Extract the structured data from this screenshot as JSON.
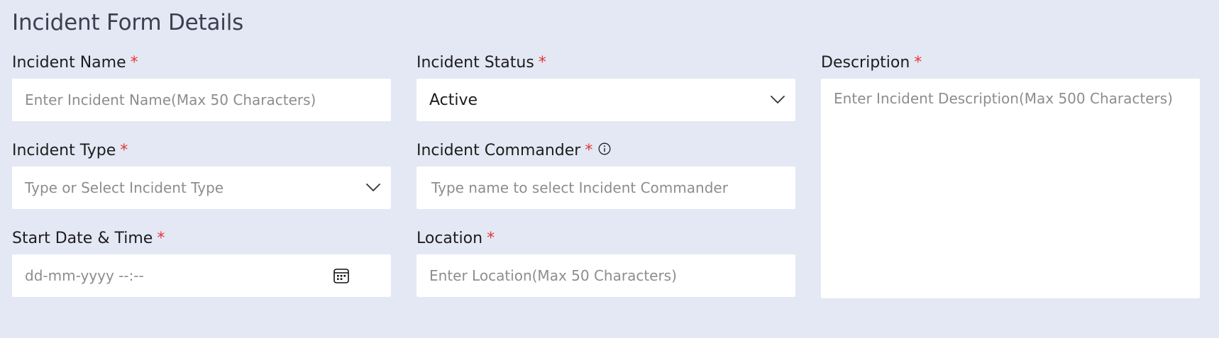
{
  "page": {
    "title": "Incident Form Details",
    "required_marker": "*"
  },
  "fields": {
    "incident_name": {
      "label": "Incident Name",
      "placeholder": "Enter Incident Name(Max 50 Characters)"
    },
    "incident_status": {
      "label": "Incident Status",
      "value": "Active"
    },
    "description": {
      "label": "Description",
      "placeholder": "Enter Incident Description(Max 500 Characters)"
    },
    "incident_type": {
      "label": "Incident Type",
      "placeholder": "Type or Select Incident Type"
    },
    "incident_commander": {
      "label": "Incident Commander",
      "placeholder": "Type name to select Incident Commander"
    },
    "start_datetime": {
      "label": "Start Date & Time",
      "placeholder": "dd-mm-yyyy --:--"
    },
    "location": {
      "label": "Location",
      "placeholder": "Enter Location(Max 50 Characters)"
    }
  },
  "colors": {
    "background": "#e4e8f4",
    "required": "#e5353a",
    "placeholder": "#8d8d8d",
    "field_background": "#ffffff"
  },
  "icons": {
    "dropdown": "chevron-down-icon",
    "info": "info-icon",
    "calendar": "calendar-icon"
  }
}
